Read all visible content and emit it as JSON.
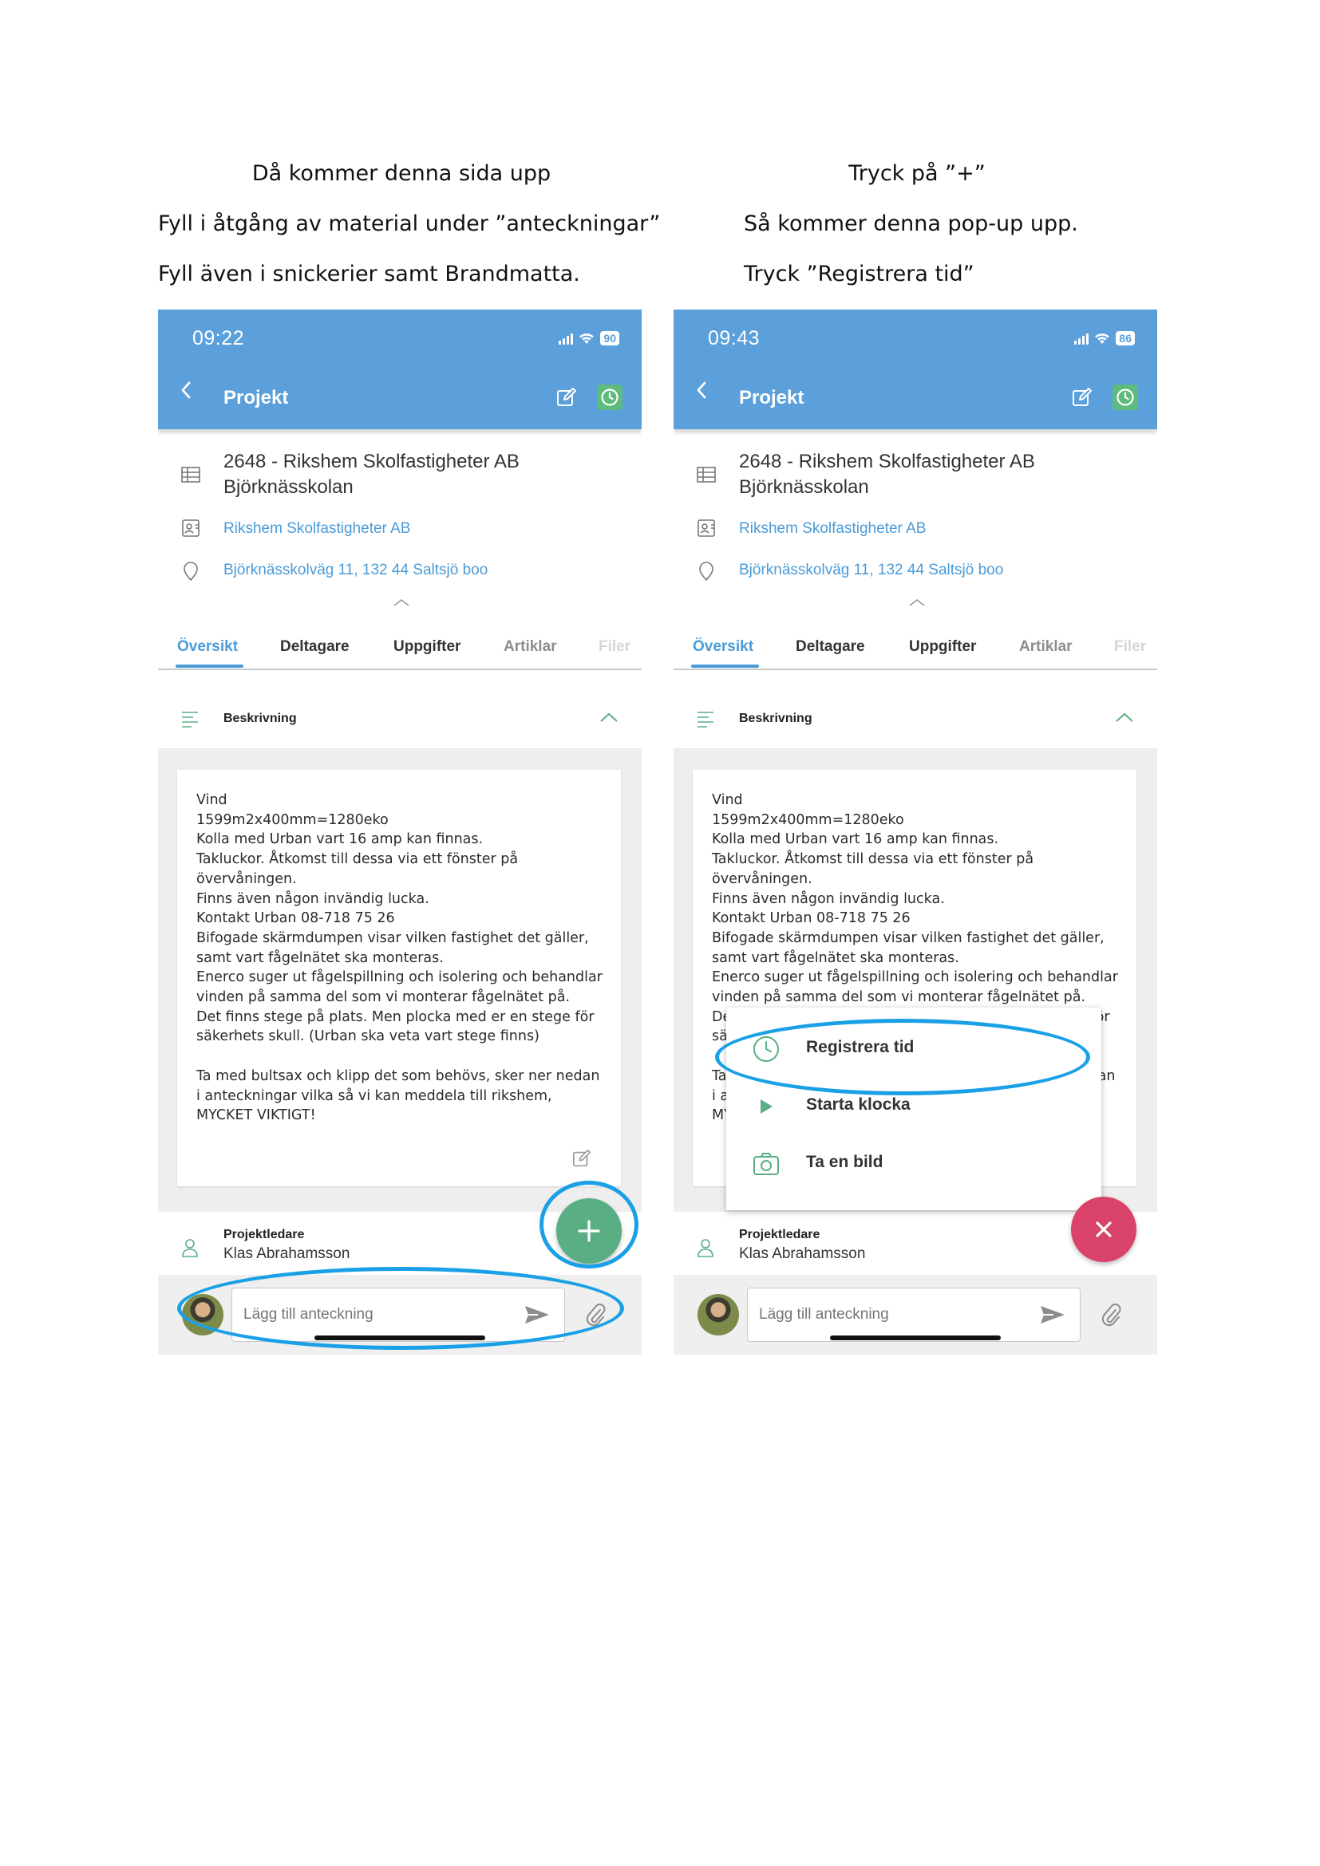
{
  "left": {
    "heading": "Då kommer denna sida upp",
    "line1": "Fyll i åtgång av material under ”anteckningar”",
    "line2": "Fyll även i snickerier samt Brandmatta.",
    "phone": {
      "time": "09:22",
      "battery": "90"
    }
  },
  "right": {
    "heading": "Tryck på ”+”",
    "line1": "Så kommer denna pop-up upp.",
    "line2": "Tryck ”Registrera tid”",
    "phone": {
      "time": "09:43",
      "battery": "86"
    },
    "popup": {
      "item1": "Registrera tid",
      "item2": "Starta klocka",
      "item3": "Ta en bild"
    }
  },
  "app": {
    "title": "Projekt",
    "project_line1": "2648 - Rikshem Skolfastigheter AB",
    "project_line2": "Björknässkolan",
    "customer": "Rikshem Skolfastigheter AB",
    "address": "Björknässkolväg 11, 132 44 Saltsjö boo",
    "tabs": [
      "Översikt",
      "Deltagare",
      "Uppgifter",
      "Artiklar",
      "Filer"
    ],
    "section_title": "Beskrivning",
    "description": "Vind\n1599m2x400mm=1280eko\nKolla med Urban vart 16 amp kan finnas.\nTakluckor. Åtkomst till dessa via ett fönster på övervåningen.\nFinns även någon invändig lucka.\nKontakt Urban 08-718 75 26\nBifogade skärmdumpen visar vilken fastighet det gäller, samt vart fågelnätet ska monteras.\nEnerco suger ut fågelspillning och isolering och behandlar vinden på samma del som vi monterar fågelnätet på.\nDet finns stege på plats. Men plocka med er en stege för säkerhets skull. (Urban ska veta vart stege finns)\n\nTa med bultsax och klipp det som behövs, sker ner nedan i anteckningar vilka så vi kan meddela till rikshem, MYCKET VIKTIGT!",
    "person_role": "Projektledare",
    "person_name": "Klas Abrahamsson",
    "note_placeholder": "Lägg till anteckning"
  },
  "colors": {
    "appbar": "#5b9fdb",
    "link": "#4a9bd8",
    "fab_add": "#5aae83",
    "fab_close": "#d9436b",
    "highlight": "#1aa0e6"
  }
}
